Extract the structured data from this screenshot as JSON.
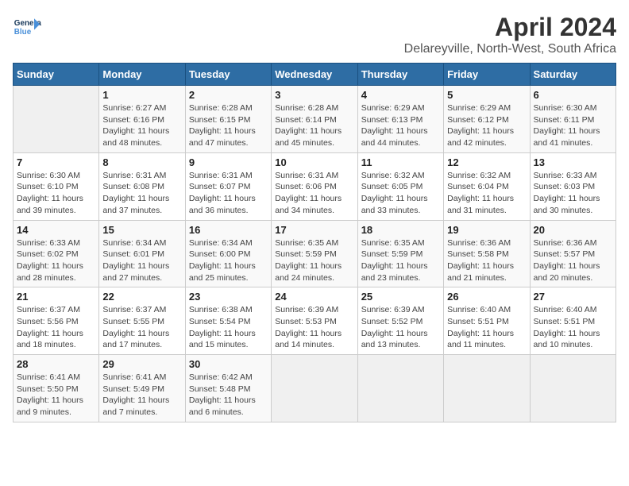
{
  "header": {
    "logo_line1": "General",
    "logo_line2": "Blue",
    "title": "April 2024",
    "subtitle": "Delareyville, North-West, South Africa"
  },
  "days_of_week": [
    "Sunday",
    "Monday",
    "Tuesday",
    "Wednesday",
    "Thursday",
    "Friday",
    "Saturday"
  ],
  "weeks": [
    [
      {
        "day": "",
        "info": ""
      },
      {
        "day": "1",
        "info": "Sunrise: 6:27 AM\nSunset: 6:16 PM\nDaylight: 11 hours\nand 48 minutes."
      },
      {
        "day": "2",
        "info": "Sunrise: 6:28 AM\nSunset: 6:15 PM\nDaylight: 11 hours\nand 47 minutes."
      },
      {
        "day": "3",
        "info": "Sunrise: 6:28 AM\nSunset: 6:14 PM\nDaylight: 11 hours\nand 45 minutes."
      },
      {
        "day": "4",
        "info": "Sunrise: 6:29 AM\nSunset: 6:13 PM\nDaylight: 11 hours\nand 44 minutes."
      },
      {
        "day": "5",
        "info": "Sunrise: 6:29 AM\nSunset: 6:12 PM\nDaylight: 11 hours\nand 42 minutes."
      },
      {
        "day": "6",
        "info": "Sunrise: 6:30 AM\nSunset: 6:11 PM\nDaylight: 11 hours\nand 41 minutes."
      }
    ],
    [
      {
        "day": "7",
        "info": "Sunrise: 6:30 AM\nSunset: 6:10 PM\nDaylight: 11 hours\nand 39 minutes."
      },
      {
        "day": "8",
        "info": "Sunrise: 6:31 AM\nSunset: 6:08 PM\nDaylight: 11 hours\nand 37 minutes."
      },
      {
        "day": "9",
        "info": "Sunrise: 6:31 AM\nSunset: 6:07 PM\nDaylight: 11 hours\nand 36 minutes."
      },
      {
        "day": "10",
        "info": "Sunrise: 6:31 AM\nSunset: 6:06 PM\nDaylight: 11 hours\nand 34 minutes."
      },
      {
        "day": "11",
        "info": "Sunrise: 6:32 AM\nSunset: 6:05 PM\nDaylight: 11 hours\nand 33 minutes."
      },
      {
        "day": "12",
        "info": "Sunrise: 6:32 AM\nSunset: 6:04 PM\nDaylight: 11 hours\nand 31 minutes."
      },
      {
        "day": "13",
        "info": "Sunrise: 6:33 AM\nSunset: 6:03 PM\nDaylight: 11 hours\nand 30 minutes."
      }
    ],
    [
      {
        "day": "14",
        "info": "Sunrise: 6:33 AM\nSunset: 6:02 PM\nDaylight: 11 hours\nand 28 minutes."
      },
      {
        "day": "15",
        "info": "Sunrise: 6:34 AM\nSunset: 6:01 PM\nDaylight: 11 hours\nand 27 minutes."
      },
      {
        "day": "16",
        "info": "Sunrise: 6:34 AM\nSunset: 6:00 PM\nDaylight: 11 hours\nand 25 minutes."
      },
      {
        "day": "17",
        "info": "Sunrise: 6:35 AM\nSunset: 5:59 PM\nDaylight: 11 hours\nand 24 minutes."
      },
      {
        "day": "18",
        "info": "Sunrise: 6:35 AM\nSunset: 5:59 PM\nDaylight: 11 hours\nand 23 minutes."
      },
      {
        "day": "19",
        "info": "Sunrise: 6:36 AM\nSunset: 5:58 PM\nDaylight: 11 hours\nand 21 minutes."
      },
      {
        "day": "20",
        "info": "Sunrise: 6:36 AM\nSunset: 5:57 PM\nDaylight: 11 hours\nand 20 minutes."
      }
    ],
    [
      {
        "day": "21",
        "info": "Sunrise: 6:37 AM\nSunset: 5:56 PM\nDaylight: 11 hours\nand 18 minutes."
      },
      {
        "day": "22",
        "info": "Sunrise: 6:37 AM\nSunset: 5:55 PM\nDaylight: 11 hours\nand 17 minutes."
      },
      {
        "day": "23",
        "info": "Sunrise: 6:38 AM\nSunset: 5:54 PM\nDaylight: 11 hours\nand 15 minutes."
      },
      {
        "day": "24",
        "info": "Sunrise: 6:39 AM\nSunset: 5:53 PM\nDaylight: 11 hours\nand 14 minutes."
      },
      {
        "day": "25",
        "info": "Sunrise: 6:39 AM\nSunset: 5:52 PM\nDaylight: 11 hours\nand 13 minutes."
      },
      {
        "day": "26",
        "info": "Sunrise: 6:40 AM\nSunset: 5:51 PM\nDaylight: 11 hours\nand 11 minutes."
      },
      {
        "day": "27",
        "info": "Sunrise: 6:40 AM\nSunset: 5:51 PM\nDaylight: 11 hours\nand 10 minutes."
      }
    ],
    [
      {
        "day": "28",
        "info": "Sunrise: 6:41 AM\nSunset: 5:50 PM\nDaylight: 11 hours\nand 9 minutes."
      },
      {
        "day": "29",
        "info": "Sunrise: 6:41 AM\nSunset: 5:49 PM\nDaylight: 11 hours\nand 7 minutes."
      },
      {
        "day": "30",
        "info": "Sunrise: 6:42 AM\nSunset: 5:48 PM\nDaylight: 11 hours\nand 6 minutes."
      },
      {
        "day": "",
        "info": ""
      },
      {
        "day": "",
        "info": ""
      },
      {
        "day": "",
        "info": ""
      },
      {
        "day": "",
        "info": ""
      }
    ]
  ]
}
